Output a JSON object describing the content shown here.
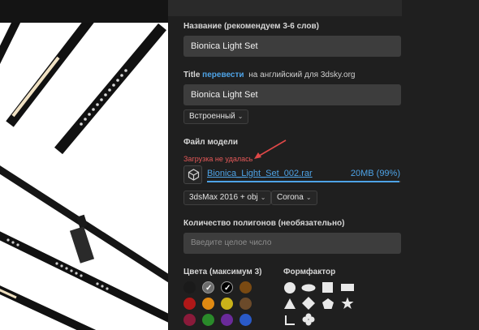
{
  "form": {
    "name_label": "Название (рекомендуем 3-6 слов)",
    "name_value": "Bionica Light Set",
    "title_label": "Title",
    "title_translate_link": "перевести",
    "title_label_rest": "на английский для 3dsky.org",
    "title_value": "Bionica Light Set",
    "render_mode_dropdown": "Встроенный",
    "model_file_label": "Файл модели",
    "upload_error": "Загрузка не удалась",
    "file": {
      "name": "Bionica_Light_Set_002.rar",
      "size_status": "20MB (99%)",
      "progress_percent": 99
    },
    "software_dropdown": "3dsMax 2016 + obj",
    "renderer_dropdown": "Corona",
    "polygons_label": "Количество полигонов (необязательно)",
    "polygons_placeholder": "Введите целое число",
    "colors_label": "Цвета (максимум 3)",
    "formfactor_label": "Формфактор"
  },
  "colors": [
    {
      "hex": "#1a1a1a",
      "selected": false
    },
    {
      "hex": "#6d6d6d",
      "selected": true
    },
    {
      "hex": "#000000",
      "selected": true
    },
    {
      "hex": "#7a4a12",
      "selected": false
    },
    {
      "hex": "#b01818",
      "selected": false
    },
    {
      "hex": "#e08a12",
      "selected": false
    },
    {
      "hex": "#c9b21a",
      "selected": false
    },
    {
      "hex": "#6b4a2a",
      "selected": false
    },
    {
      "hex": "#8a1a3a",
      "selected": false
    },
    {
      "hex": "#2a8a2a",
      "selected": false
    },
    {
      "hex": "#6a2a9a",
      "selected": false
    },
    {
      "hex": "#2a5ac8",
      "selected": false
    }
  ],
  "formfactor_icons": [
    "circle-icon",
    "ellipse-icon",
    "square-icon",
    "rectangle-icon",
    "triangle-icon",
    "diamond-icon",
    "pentagon-icon",
    "star-icon",
    "corner-icon",
    "flower-icon"
  ],
  "annotation_color": "#e04848"
}
